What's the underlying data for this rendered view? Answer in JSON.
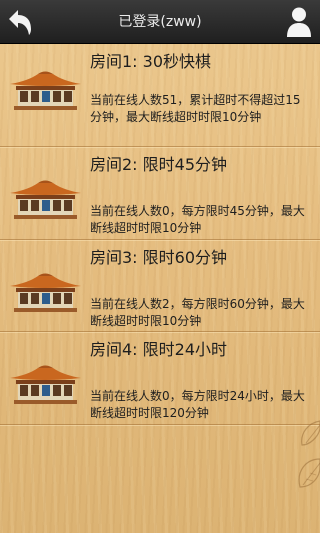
{
  "header": {
    "title": "已登录(zww)",
    "back_icon": "back-arrow-icon",
    "profile_icon": "user-icon"
  },
  "rooms": [
    {
      "title": "房间1: 30秒快棋",
      "description": "当前在线人数51，累计超时不得超过15分钟，最大断线超时时限10分钟"
    },
    {
      "title": "房间2: 限时45分钟",
      "description": "当前在线人数0，每方限时45分钟，最大断线超时时限10分钟"
    },
    {
      "title": "房间3: 限时60分钟",
      "description": "当前在线人数2，每方限时60分钟，最大断线超时时限10分钟"
    },
    {
      "title": "房间4: 限时24小时",
      "description": "当前在线人数0，每方限时24小时，最大断线超时时限120分钟"
    }
  ],
  "colors": {
    "header_bg": "#2a2a2a",
    "background": "#e5bd80",
    "roof": "#c9671f",
    "text": "#1e1e1e"
  }
}
